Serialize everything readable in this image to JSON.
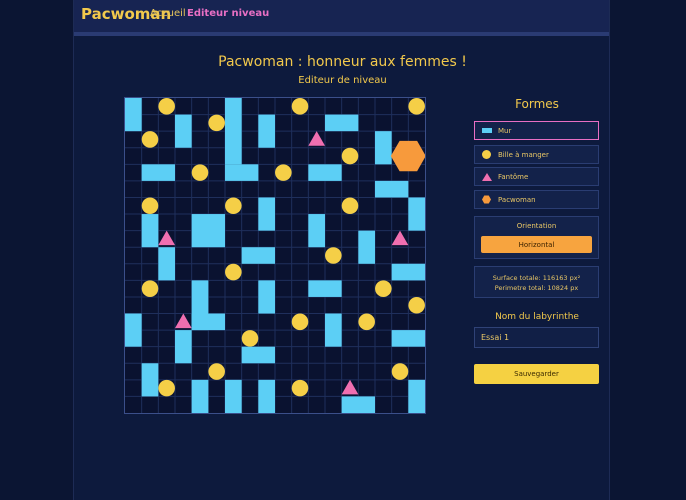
{
  "nav": {
    "brand": "Pacwoman",
    "home": "Accueil",
    "editor": "Editeur niveau"
  },
  "page": {
    "title": "Pacwoman : honneur aux femmes !",
    "subtitle": "Editeur de niveau"
  },
  "colors": {
    "background": "#0b1533",
    "accent": "#f2c94c",
    "active_nav": "#e86fc4",
    "wall": "#5ccff5",
    "ball": "#f5cf47",
    "ghost": "#f06fb0",
    "pacwoman": "#f79a3c"
  },
  "shapes_panel": {
    "title": "Formes",
    "items": [
      {
        "label": "Mur",
        "icon": "wall-icon",
        "active": true
      },
      {
        "label": "Bille à manger",
        "icon": "ball-icon",
        "active": false
      },
      {
        "label": "Fantôme",
        "icon": "ghost-icon",
        "active": false
      },
      {
        "label": "Pacwoman",
        "icon": "hexagon-icon",
        "active": false
      }
    ]
  },
  "orientation": {
    "label": "Orientation",
    "value": "Horizontal"
  },
  "stats": {
    "surface": "Surface totale: 116163 px²",
    "perimeter": "Perimetre total: 10824 px"
  },
  "maze_name": {
    "label": "Nom du labyrinthe",
    "value": "Essai 1"
  },
  "save_label": "Sauvegarder",
  "grid": {
    "cols": 18,
    "rows": 19,
    "walls": [
      [
        0,
        0,
        1,
        2
      ],
      [
        6,
        0,
        1,
        4
      ],
      [
        3,
        1,
        1,
        2
      ],
      [
        8,
        1,
        1,
        2
      ],
      [
        12,
        1,
        2,
        1
      ],
      [
        15,
        2,
        1,
        2
      ],
      [
        1,
        4,
        2,
        1
      ],
      [
        6,
        4,
        2,
        1
      ],
      [
        11,
        4,
        2,
        1
      ],
      [
        15,
        5,
        2,
        1
      ],
      [
        17,
        6,
        1,
        2
      ],
      [
        8,
        6,
        1,
        2
      ],
      [
        1,
        7,
        1,
        2
      ],
      [
        4,
        7,
        2,
        2
      ],
      [
        11,
        7,
        1,
        2
      ],
      [
        14,
        8,
        1,
        2
      ],
      [
        7,
        9,
        2,
        1
      ],
      [
        2,
        9,
        1,
        2
      ],
      [
        16,
        10,
        2,
        1
      ],
      [
        8,
        11,
        1,
        2
      ],
      [
        11,
        11,
        2,
        1
      ],
      [
        4,
        11,
        1,
        3
      ],
      [
        4,
        13,
        2,
        1
      ],
      [
        0,
        13,
        1,
        2
      ],
      [
        3,
        14,
        1,
        2
      ],
      [
        12,
        13,
        1,
        2
      ],
      [
        16,
        14,
        2,
        1
      ],
      [
        7,
        15,
        2,
        1
      ],
      [
        1,
        16,
        1,
        2
      ],
      [
        4,
        17,
        1,
        2
      ],
      [
        6,
        17,
        1,
        2
      ],
      [
        8,
        17,
        1,
        2
      ],
      [
        13,
        18,
        2,
        1
      ],
      [
        17,
        17,
        1,
        2
      ]
    ],
    "balls": [
      [
        2.5,
        0.5
      ],
      [
        10.5,
        0.5
      ],
      [
        17.5,
        0.5
      ],
      [
        1.5,
        2.5
      ],
      [
        5.5,
        1.5
      ],
      [
        13.5,
        3.5
      ],
      [
        4.5,
        4.5
      ],
      [
        9.5,
        4.5
      ],
      [
        1.5,
        6.5
      ],
      [
        6.5,
        6.5
      ],
      [
        13.5,
        6.5
      ],
      [
        12.5,
        9.5
      ],
      [
        6.5,
        10.5
      ],
      [
        1.5,
        11.5
      ],
      [
        15.5,
        11.5
      ],
      [
        17.5,
        12.5
      ],
      [
        10.5,
        13.5
      ],
      [
        14.5,
        13.5
      ],
      [
        7.5,
        14.5
      ],
      [
        5.5,
        16.5
      ],
      [
        16.5,
        16.5
      ],
      [
        2.5,
        17.5
      ],
      [
        10.5,
        17.5
      ]
    ],
    "ghosts": [
      [
        11.5,
        2.5
      ],
      [
        2.5,
        8.5
      ],
      [
        16.5,
        8.5
      ],
      [
        3.5,
        13.5
      ],
      [
        13.5,
        17.5
      ]
    ],
    "pacwoman": [
      17,
      3.5
    ]
  }
}
